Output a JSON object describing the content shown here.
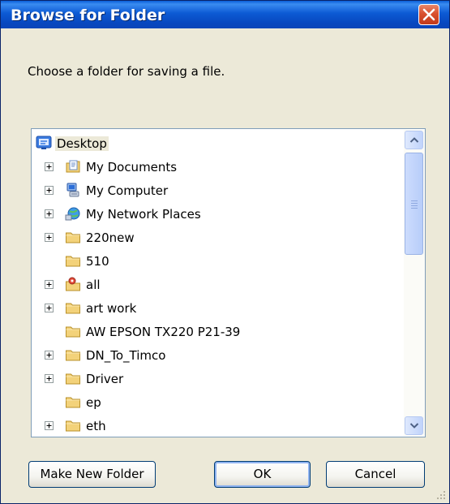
{
  "window": {
    "title": "Browse for Folder"
  },
  "prompt": "Choose a folder for saving a file.",
  "tree": {
    "items": [
      {
        "label": "Desktop",
        "icon": "desktop-icon",
        "expander": false,
        "level": 0,
        "selected": true
      },
      {
        "label": "My Documents",
        "icon": "my-documents-icon",
        "expander": true,
        "level": 1
      },
      {
        "label": "My Computer",
        "icon": "my-computer-icon",
        "expander": true,
        "level": 1
      },
      {
        "label": "My Network Places",
        "icon": "network-places-icon",
        "expander": true,
        "level": 1
      },
      {
        "label": "220new",
        "icon": "folder-icon",
        "expander": true,
        "level": 1
      },
      {
        "label": "510",
        "icon": "folder-icon",
        "expander": false,
        "level": 1
      },
      {
        "label": "all",
        "icon": "shared-folder-icon",
        "expander": true,
        "level": 1
      },
      {
        "label": "art work",
        "icon": "folder-icon",
        "expander": true,
        "level": 1
      },
      {
        "label": "AW EPSON TX220 P21-39",
        "icon": "folder-icon",
        "expander": false,
        "level": 1
      },
      {
        "label": "DN_To_Timco",
        "icon": "folder-icon",
        "expander": true,
        "level": 1
      },
      {
        "label": "Driver",
        "icon": "folder-icon",
        "expander": true,
        "level": 1
      },
      {
        "label": "ep",
        "icon": "folder-icon",
        "expander": false,
        "level": 1
      },
      {
        "label": "eth",
        "icon": "folder-icon",
        "expander": true,
        "level": 1
      }
    ]
  },
  "buttons": {
    "new_folder": "Make New Folder",
    "ok": "OK",
    "cancel": "Cancel"
  },
  "colors": {
    "title_bar": "#0a5fd8",
    "dialog_face": "#ece9d8",
    "close_button": "#d9512f",
    "folder": "#f3d27a"
  }
}
